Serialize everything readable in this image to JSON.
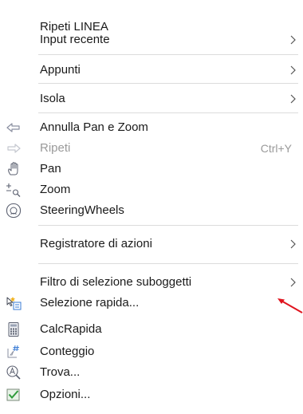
{
  "menu": {
    "items": [
      {
        "label": "Ripeti LINEA"
      },
      {
        "label": "Input recente"
      },
      {
        "label": "Appunti"
      },
      {
        "label": "Isola"
      },
      {
        "label": "Annulla Pan e Zoom",
        "icon": "undo-arrow-icon"
      },
      {
        "label": "Ripeti",
        "shortcut": "Ctrl+Y",
        "icon": "redo-arrow-icon",
        "disabled": true
      },
      {
        "label": "Pan",
        "icon": "hand-pan-icon"
      },
      {
        "label": "Zoom",
        "icon": "zoom-icon"
      },
      {
        "label": "SteeringWheels",
        "icon": "steering-wheel-icon"
      },
      {
        "label": "Registratore di azioni"
      },
      {
        "label": "Filtro di selezione suboggetti"
      },
      {
        "label": "Selezione rapida...",
        "icon": "quick-select-icon"
      },
      {
        "label": "CalcRapida",
        "icon": "calculator-icon"
      },
      {
        "label": "Conteggio",
        "icon": "count-icon"
      },
      {
        "label": "Trova...",
        "icon": "find-icon"
      },
      {
        "label": "Opzioni...",
        "icon": "options-checkmark-icon"
      }
    ]
  },
  "colors": {
    "text": "#1a1a1a",
    "disabled_text": "#9a9a9a",
    "separator": "#dcdcdc",
    "annotation_arrow": "#e0141e"
  }
}
